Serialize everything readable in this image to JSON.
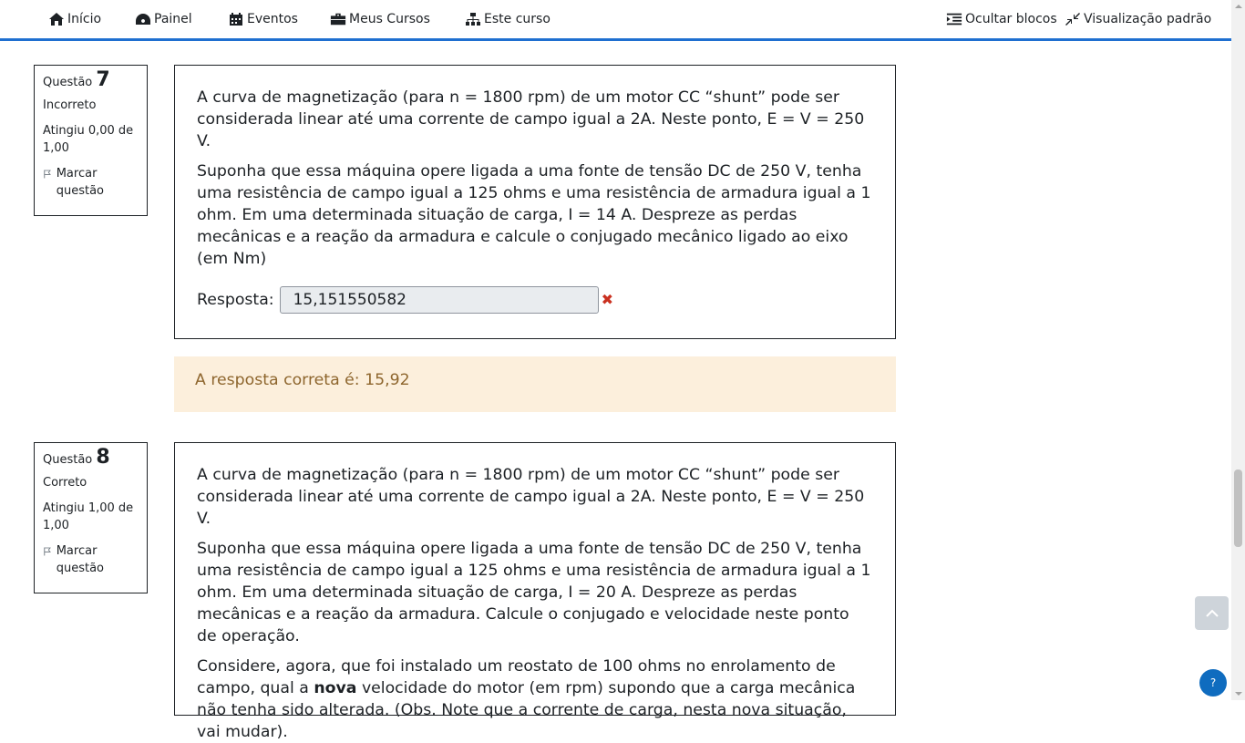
{
  "nav": {
    "home": "Início",
    "dashboard": "Painel",
    "events": "Eventos",
    "my_courses": "Meus Cursos",
    "this_course": "Este curso",
    "hide_blocks": "Ocultar blocos",
    "standard_view": "Visualização padrão"
  },
  "questions": [
    {
      "label": "Questão",
      "number": "7",
      "state": "Incorreto",
      "grade": "Atingiu 0,00 de 1,00",
      "flag": "Marcar questão",
      "text": [
        "A curva de magnetização (para n = 1800 rpm) de um motor CC “shunt” pode ser considerada linear até uma corrente de campo igual a 2A. Neste ponto, E = V = 250 V.",
        "Suponha que essa máquina opere ligada a uma fonte de tensão DC de 250 V, tenha uma resistência de campo igual a 125 ohms e uma resistência de armadura igual a 1 ohm. Em uma determinada situação de carga, I = 14 A. Despreze as perdas mecânicas e a reação da armadura e calcule o conjugado mecânico ligado ao eixo (em Nm)"
      ],
      "answer_label": "Resposta:",
      "answer_value": "15,151550582",
      "feedback": "A resposta correta é: 15,92"
    },
    {
      "label": "Questão",
      "number": "8",
      "state": "Correto",
      "grade": "Atingiu 1,00 de 1,00",
      "flag": "Marcar questão",
      "text": [
        "A curva de magnetização (para n = 1800 rpm) de um motor CC “shunt” pode ser considerada linear até uma corrente de campo igual a 2A. Neste ponto, E = V = 250 V.",
        "Suponha que essa máquina opere ligada a uma fonte de tensão DC de 250 V, tenha uma resistência de campo igual a 125 ohms e uma resistência de armadura igual a 1 ohm. Em uma determinada situação de carga, I = 20 A. Despreze as perdas mecânicas e a reação da armadura. Calcule o conjugado e velocidade neste ponto de operação."
      ],
      "text3_before": "Considere, agora, que foi instalado um reostato de 100 ohms no enrolamento de campo, qual a ",
      "text3_bold": "nova",
      "text3_after": " velocidade do motor (em rpm) supondo que a carga mecânica não tenha sido alterada. (Obs. Note que a corrente de carga, nesta nova situação, vai mudar)."
    }
  ],
  "help_label": "?",
  "colors": {
    "accent": "#1f6fd0",
    "feedback_bg": "#fcefdc",
    "feedback_text": "#8e662e",
    "wrong": "#ca3120"
  }
}
